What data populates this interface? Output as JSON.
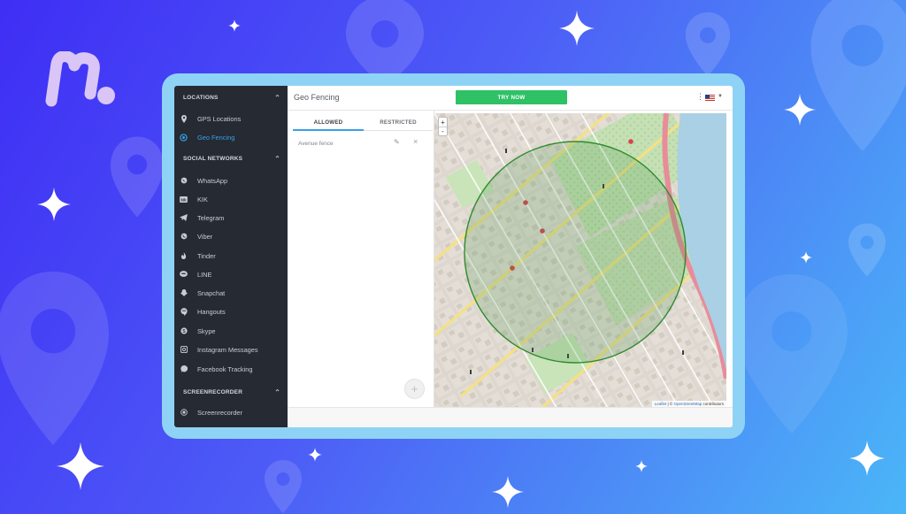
{
  "app": {
    "page_title": "Geo Fencing",
    "try_now_label": "TRY NOW",
    "brand_color": "#2fc166",
    "accent_color": "#36a2ea"
  },
  "sidebar": {
    "sections": [
      {
        "title": "LOCATIONS",
        "items": [
          {
            "label": "GPS Locations",
            "icon": "map-pin-icon"
          },
          {
            "label": "Geo Fencing",
            "icon": "geofence-icon",
            "active": true
          }
        ]
      },
      {
        "title": "SOCIAL NETWORKS",
        "items": [
          {
            "label": "WhatsApp",
            "icon": "whatsapp-icon"
          },
          {
            "label": "KIK",
            "icon": "kik-icon"
          },
          {
            "label": "Telegram",
            "icon": "telegram-icon"
          },
          {
            "label": "Viber",
            "icon": "viber-icon"
          },
          {
            "label": "Tinder",
            "icon": "tinder-icon"
          },
          {
            "label": "LINE",
            "icon": "line-icon"
          },
          {
            "label": "Snapchat",
            "icon": "snapchat-icon"
          },
          {
            "label": "Hangouts",
            "icon": "hangouts-icon"
          },
          {
            "label": "Skype",
            "icon": "skype-icon"
          },
          {
            "label": "Instagram Messages",
            "icon": "instagram-icon"
          },
          {
            "label": "Facebook Tracking",
            "icon": "messenger-icon"
          }
        ]
      },
      {
        "title": "SCREENRECORDER",
        "items": [
          {
            "label": "Screenrecorder",
            "icon": "record-icon"
          }
        ]
      }
    ]
  },
  "fence_panel": {
    "tabs": [
      {
        "label": "ALLOWED",
        "selected": true
      },
      {
        "label": "RESTRICTED",
        "selected": false
      }
    ],
    "fences": [
      {
        "name": "Avenue fence"
      }
    ],
    "add_button": "+"
  },
  "map": {
    "zoom_in": "+",
    "zoom_out": "-",
    "attribution_lib": "Leaflet",
    "attribution_sep": " | © ",
    "attribution_src": "OpenStreetMap",
    "attribution_tail": " contributors",
    "geofence_color": "#2e8b2e"
  }
}
